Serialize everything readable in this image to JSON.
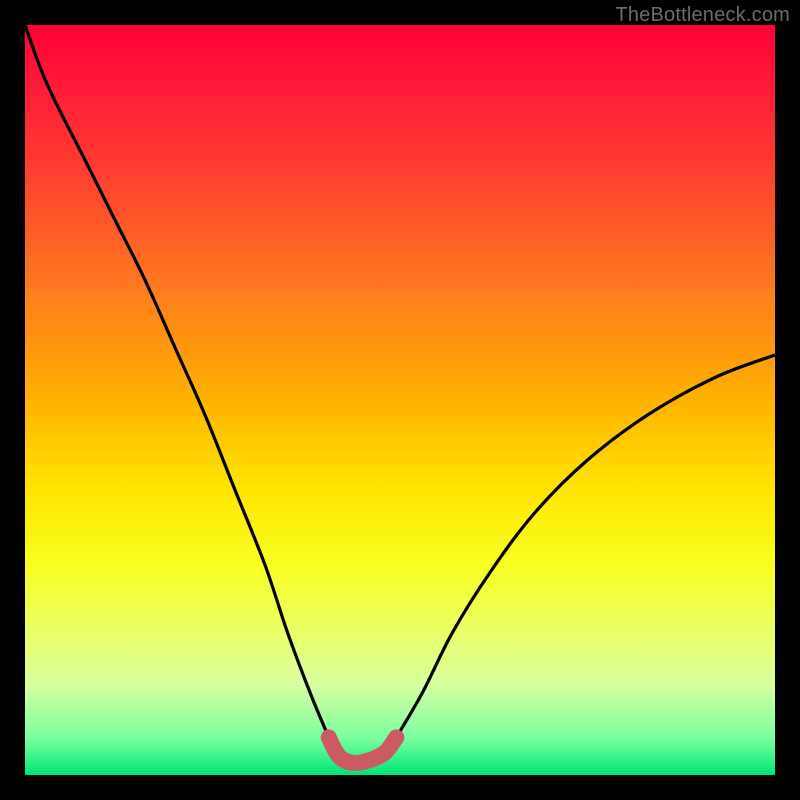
{
  "watermark": "TheBottleneck.com",
  "colors": {
    "curve_stroke": "#000000",
    "accent_valley": "#cc5a62"
  },
  "chart_data": {
    "type": "line",
    "title": "",
    "xlabel": "",
    "ylabel": "",
    "xlim": [
      0,
      100
    ],
    "ylim": [
      0,
      100
    ],
    "grid": false,
    "legend": false,
    "series": [
      {
        "name": "left_branch_black",
        "description": "left descending curve (black)",
        "x": [
          0,
          3,
          8,
          12,
          16,
          20,
          24,
          28,
          32,
          35,
          38,
          40.5
        ],
        "values": [
          100,
          92,
          82,
          74,
          66,
          57,
          48,
          38,
          28,
          19,
          11,
          5
        ]
      },
      {
        "name": "right_branch_black",
        "description": "right ascending curve (black)",
        "x": [
          49.5,
          53,
          57,
          62,
          68,
          75,
          83,
          92,
          100
        ],
        "values": [
          5,
          11,
          19,
          27,
          35,
          42,
          48,
          53,
          56
        ]
      },
      {
        "name": "valley_pink",
        "description": "pink/red thick valley segment near bottom",
        "x": [
          40.5,
          41.5,
          42.5,
          44,
          46,
          48,
          49.5
        ],
        "values": [
          5,
          3,
          2,
          1.6,
          2,
          3,
          5
        ]
      }
    ]
  }
}
